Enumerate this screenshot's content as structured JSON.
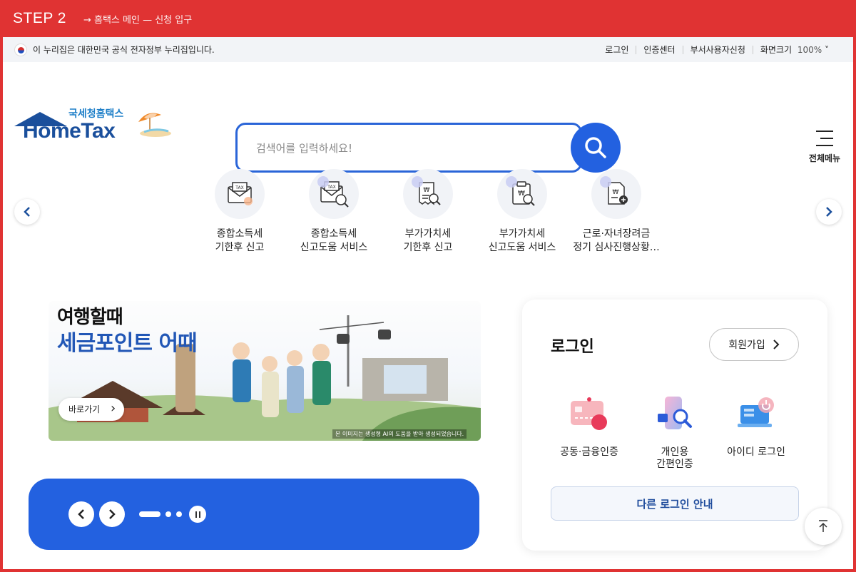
{
  "step_bar": {
    "step": "STEP 2",
    "crumb": "→ 홈택스 메인 — 신청 입구"
  },
  "gov_bar": {
    "notice": "이 누리집은 대한민국 공식 전자정부 누리집입니다.",
    "links": [
      "로그인",
      "인증센터",
      "부서사용자신청",
      "화면크기"
    ],
    "zoom": "100%"
  },
  "logo": {
    "korean": "국세청홈택스",
    "english": "HomeTax"
  },
  "search": {
    "placeholder": "검색어를 입력하세요!"
  },
  "all_menu": {
    "label": "전체메뉴"
  },
  "quick_menu": [
    {
      "line1": "종합소득세",
      "line2": "기한후 신고",
      "icon": "tax-envelope-icon"
    },
    {
      "line1": "종합소득세",
      "line2": "신고도움 서비스",
      "icon": "tax-envelope-search-icon"
    },
    {
      "line1": "부가가치세",
      "line2": "기한후 신고",
      "icon": "receipt-search-icon"
    },
    {
      "line1": "부가가치세",
      "line2": "신고도움 서비스",
      "icon": "clipboard-search-icon"
    },
    {
      "line1": "근로·자녀장려금",
      "line2": "정기 심사진행상황…",
      "icon": "document-add-icon"
    }
  ],
  "banner": {
    "line1": "여행할때",
    "line2": "세금포인트 어때",
    "button": "바로가기",
    "note": "본 이미지는 생성형 AI의 도움을 받아 생성되었습니다."
  },
  "login": {
    "title": "로그인",
    "join": "회원가입",
    "methods": [
      {
        "label": "공동·금융인증",
        "icon": "certificate-card-icon"
      },
      {
        "label": "개인용\n간편인증",
        "icon": "phone-search-icon"
      },
      {
        "label": "아이디 로그인",
        "icon": "laptop-power-icon"
      }
    ],
    "other": "다른 로그인 안내"
  },
  "colors": {
    "step_bar": "#e03333",
    "primary": "#2361e0",
    "logo_blue": "#1a4f9c"
  }
}
